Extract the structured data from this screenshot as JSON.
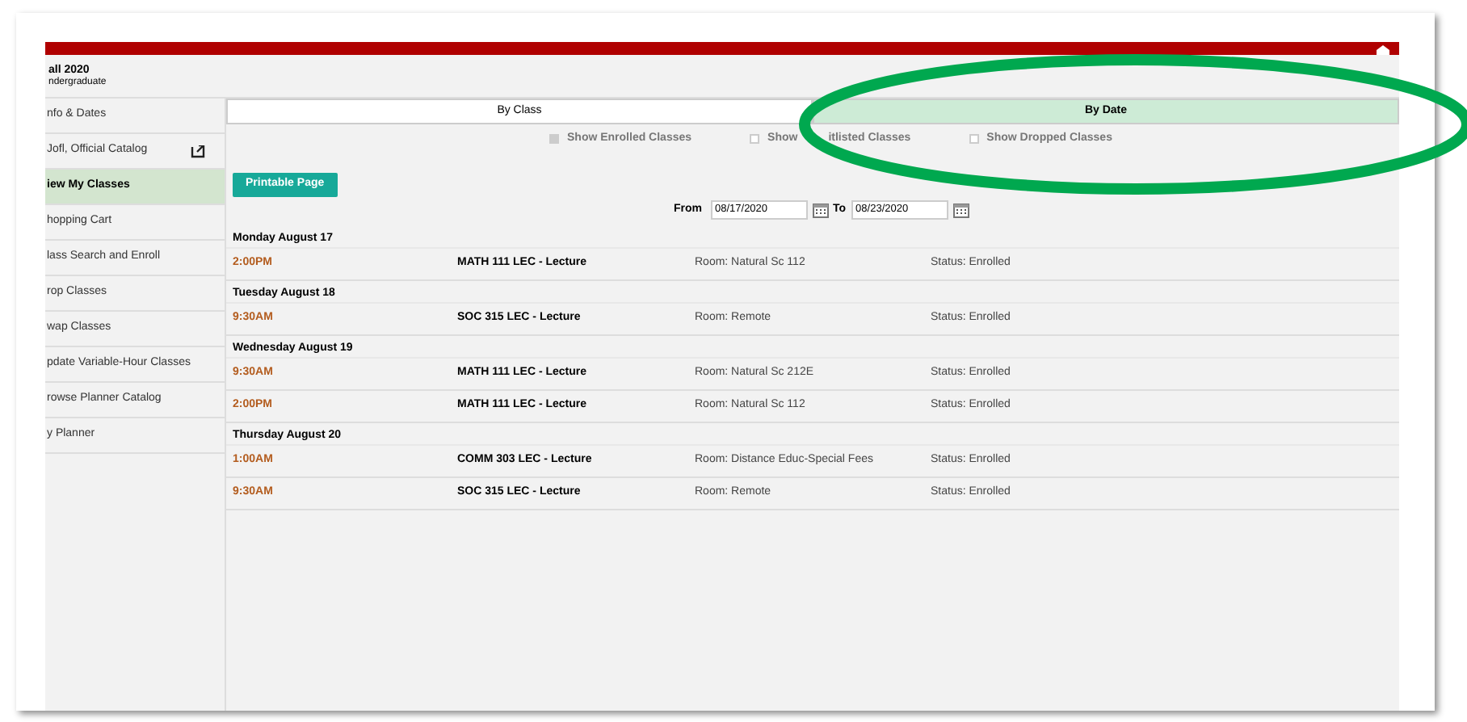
{
  "term": {
    "name": "all 2020",
    "career": "ndergraduate"
  },
  "sidebar": {
    "items": [
      {
        "label": "nfo & Dates",
        "selected": false,
        "external": false
      },
      {
        "label": "Jofl, Official Catalog",
        "selected": false,
        "external": true
      },
      {
        "label": "iew My Classes",
        "selected": true,
        "external": false
      },
      {
        "label": "hopping Cart",
        "selected": false,
        "external": false
      },
      {
        "label": "lass Search and Enroll",
        "selected": false,
        "external": false
      },
      {
        "label": "rop Classes",
        "selected": false,
        "external": false
      },
      {
        "label": "wap Classes",
        "selected": false,
        "external": false
      },
      {
        "label": "pdate Variable-Hour Classes",
        "selected": false,
        "external": false
      },
      {
        "label": "rowse Planner Catalog",
        "selected": false,
        "external": false
      },
      {
        "label": "y Planner",
        "selected": false,
        "external": false
      }
    ]
  },
  "tabs": [
    {
      "label": "By Class",
      "selected": false
    },
    {
      "label": "By Date",
      "selected": true
    }
  ],
  "filters": [
    {
      "label_parts": [
        "Show Enrolled Classes"
      ],
      "checked": true,
      "disabled": true
    },
    {
      "label_parts": [
        "Show",
        "itlisted Classes"
      ],
      "checked": false,
      "disabled": true
    },
    {
      "label_parts": [
        "Show Dropped Classes"
      ],
      "checked": false,
      "disabled": true
    }
  ],
  "printable_button": "Printable Page",
  "date_range": {
    "from_label": "From",
    "from": "08/17/2020",
    "to_label": "To",
    "to": "08/23/2020"
  },
  "days": [
    {
      "date": "Monday August 17",
      "classes": [
        {
          "time": "2:00PM",
          "class": "MATH 111 LEC - Lecture",
          "room": "Room: Natural Sc 112",
          "status": "Status: Enrolled"
        }
      ]
    },
    {
      "date": "Tuesday August 18",
      "classes": [
        {
          "time": "9:30AM",
          "class": "SOC 315 LEC - Lecture",
          "room": "Room: Remote",
          "status": "Status: Enrolled"
        }
      ]
    },
    {
      "date": "Wednesday August 19",
      "classes": [
        {
          "time": "9:30AM",
          "class": "MATH 111 LEC - Lecture",
          "room": "Room: Natural Sc 212E",
          "status": "Status: Enrolled"
        },
        {
          "time": "2:00PM",
          "class": "MATH 111 LEC - Lecture",
          "room": "Room: Natural Sc 112",
          "status": "Status: Enrolled"
        }
      ]
    },
    {
      "date": "Thursday August 20",
      "classes": [
        {
          "time": "1:00AM",
          "class": "COMM 303 LEC - Lecture",
          "room": "Room: Distance Educ-Special Fees",
          "status": "Status: Enrolled"
        },
        {
          "time": "9:30AM",
          "class": "SOC 315 LEC - Lecture",
          "room": "Room: Remote",
          "status": "Status: Enrolled"
        }
      ]
    }
  ]
}
